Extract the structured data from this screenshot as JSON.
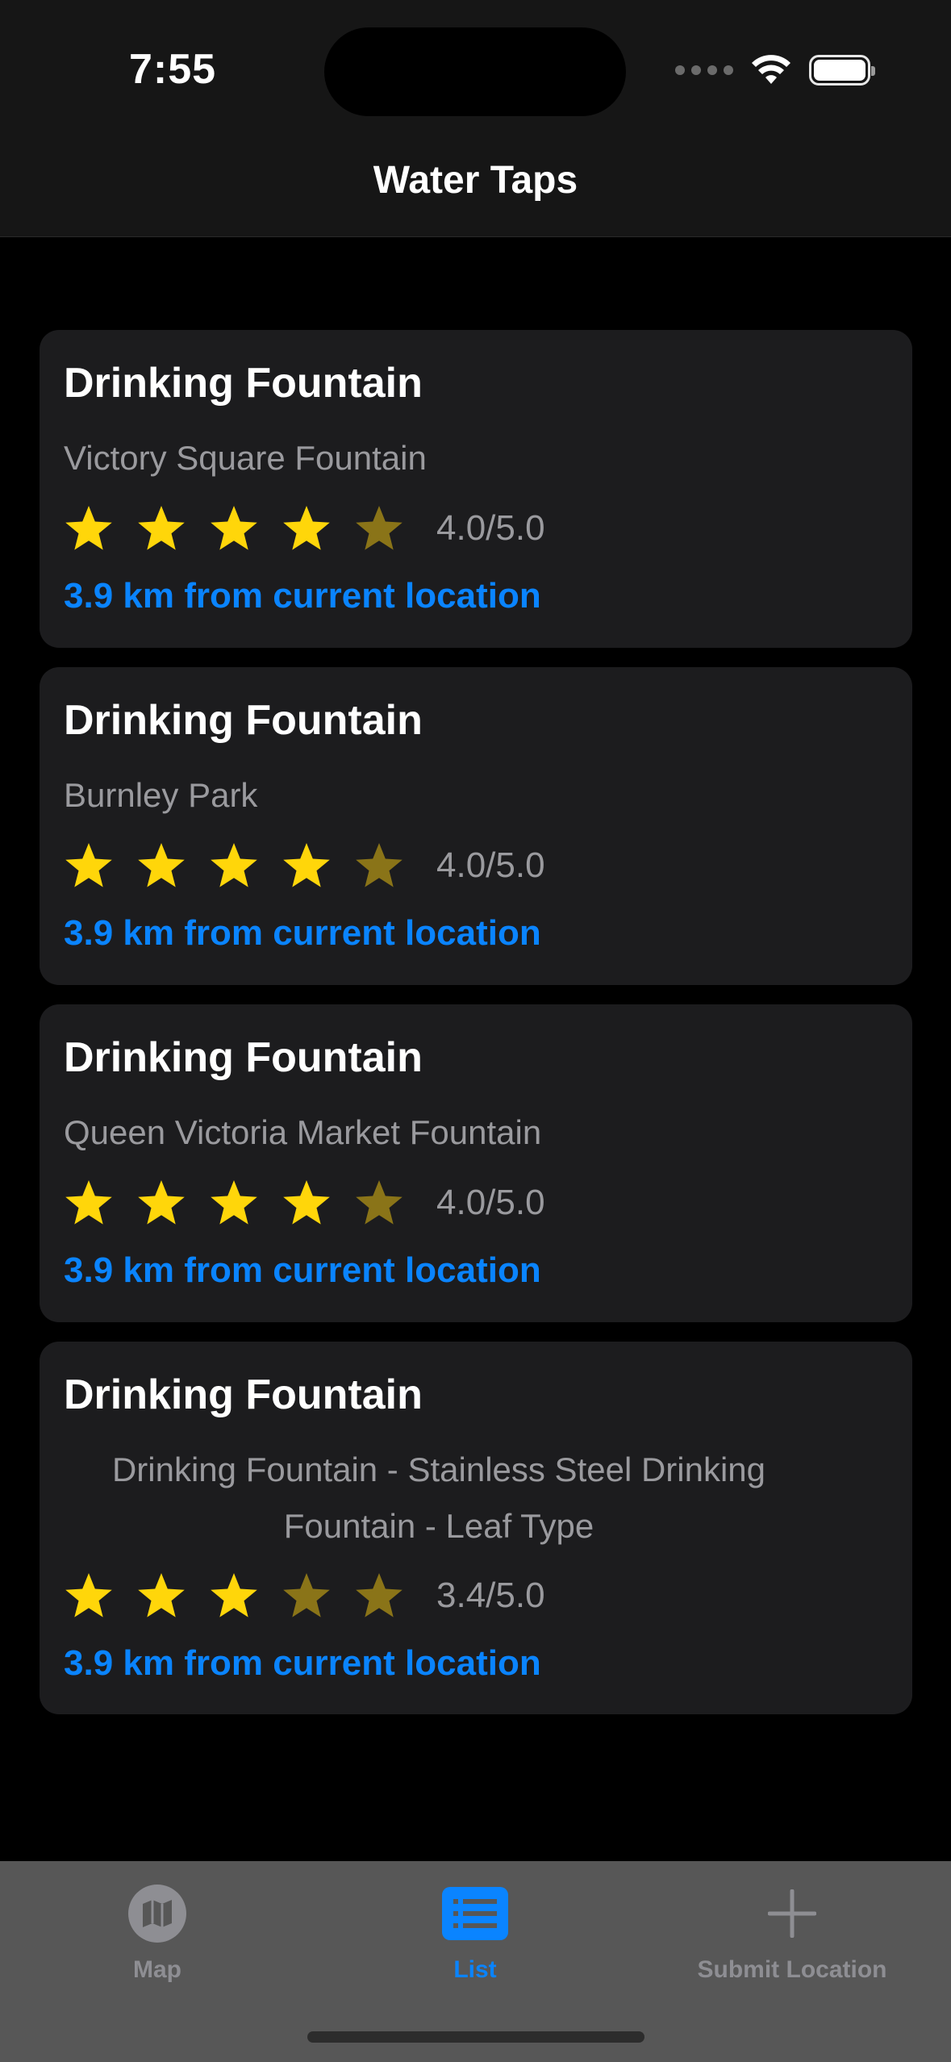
{
  "status_bar": {
    "time": "7:55"
  },
  "nav": {
    "title": "Water Taps"
  },
  "colors": {
    "accent": "#0a84ff",
    "star_full": "#ffd60a",
    "star_dim": "#8a7418",
    "inactive_tab": "#8e8e93"
  },
  "cards": [
    {
      "title": "Drinking Fountain",
      "subtitle": "Victory Square Fountain",
      "rating": 4.0,
      "rating_text": "4.0/5.0",
      "distance": "3.9 km from current location"
    },
    {
      "title": "Drinking Fountain",
      "subtitle": "Burnley Park",
      "rating": 4.0,
      "rating_text": "4.0/5.0",
      "distance": "3.9 km from current location"
    },
    {
      "title": "Drinking Fountain",
      "subtitle": "Queen Victoria Market Fountain",
      "rating": 4.0,
      "rating_text": "4.0/5.0",
      "distance": "3.9 km from current location"
    },
    {
      "title": "Drinking Fountain",
      "subtitle_lines": [
        "Drinking Fountain - Stainless Steel Drinking",
        "Fountain - Leaf Type"
      ],
      "rating": 3.4,
      "rating_text": "3.4/5.0",
      "distance": "3.9 km from current location"
    }
  ],
  "tabbar": {
    "tabs": [
      {
        "label": "Map",
        "icon": "map-icon",
        "selected": false
      },
      {
        "label": "List",
        "icon": "list-icon",
        "selected": true
      },
      {
        "label": "Submit Location",
        "icon": "plus-icon",
        "selected": false
      }
    ]
  }
}
